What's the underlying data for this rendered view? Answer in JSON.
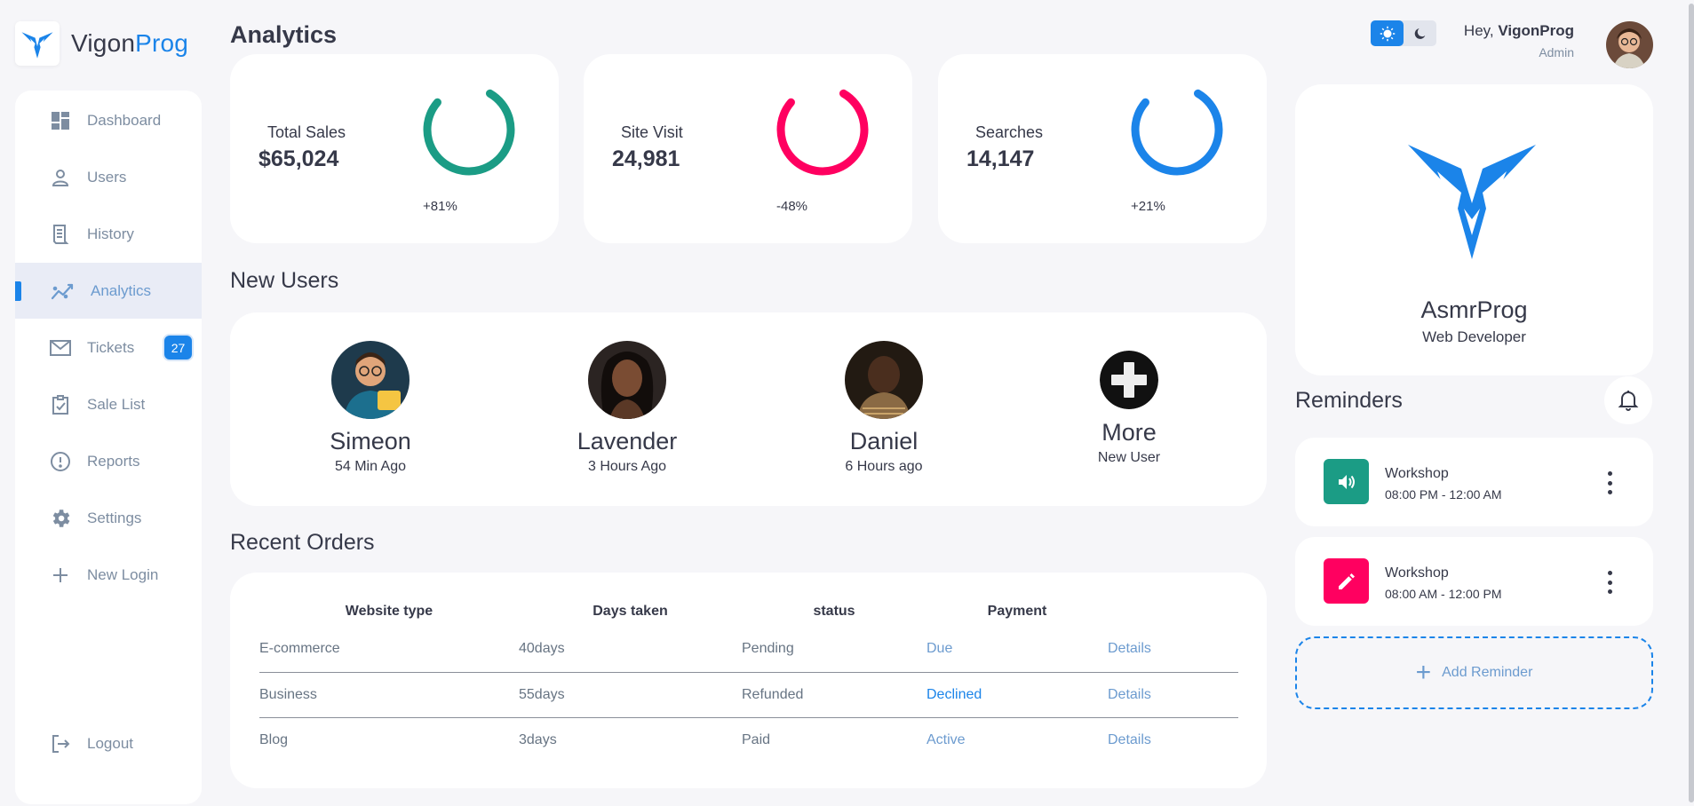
{
  "brand": {
    "name_part1": "Vigon",
    "name_part2": "Prog",
    "accent_color": "#1b84e9"
  },
  "sidebar": {
    "items": [
      {
        "label": "Dashboard",
        "icon": "dashboard-icon"
      },
      {
        "label": "Users",
        "icon": "person-icon"
      },
      {
        "label": "History",
        "icon": "receipt-icon"
      },
      {
        "label": "Analytics",
        "icon": "analytics-icon",
        "active": true
      },
      {
        "label": "Tickets",
        "icon": "mail-icon",
        "badge": "27"
      },
      {
        "label": "Sale List",
        "icon": "clipboard-check-icon"
      },
      {
        "label": "Reports",
        "icon": "report-icon"
      },
      {
        "label": "Settings",
        "icon": "gear-icon"
      },
      {
        "label": "New Login",
        "icon": "plus-icon"
      },
      {
        "label": "Logout",
        "icon": "logout-icon"
      }
    ]
  },
  "page_title": "Analytics",
  "stats": [
    {
      "label": "Total Sales",
      "value": "$65,024",
      "change": "+81%",
      "color": "#1b9c85",
      "icon": "ring-icon"
    },
    {
      "label": "Site Visit",
      "value": "24,981",
      "change": "-48%",
      "color": "#ff0060",
      "icon": "ring-icon"
    },
    {
      "label": "Searches",
      "value": "14,147",
      "change": "+21%",
      "color": "#1b84e9",
      "icon": "ring-icon"
    }
  ],
  "new_users": {
    "title": "New Users",
    "items": [
      {
        "name": "Simeon",
        "time": "54 Min Ago"
      },
      {
        "name": "Lavender",
        "time": "3 Hours Ago"
      },
      {
        "name": "Daniel",
        "time": "6 Hours ago"
      },
      {
        "name": "More",
        "time": "New User"
      }
    ]
  },
  "recent_orders": {
    "title": "Recent Orders",
    "headers": [
      "Website type",
      "Days taken",
      "status",
      "Payment",
      ""
    ],
    "rows": [
      [
        "E-commerce",
        "40days",
        "Pending",
        "Due",
        "Details"
      ],
      [
        "Business",
        "55days",
        "Refunded",
        "Declined",
        "Details"
      ],
      [
        "Blog",
        "3days",
        "Paid",
        "Active",
        "Details"
      ]
    ]
  },
  "header": {
    "greeting_prefix": "Hey,",
    "user_name": "VigonProg",
    "role": "Admin",
    "theme_light_icon": "sun-icon",
    "theme_dark_icon": "moon-icon"
  },
  "profile": {
    "name": "AsmrProg",
    "role": "Web Developer"
  },
  "reminders": {
    "title": "Reminders",
    "items": [
      {
        "title": "Workshop",
        "time": "08:00 PM - 12:00 AM",
        "color": "#1b9c85",
        "icon": "volume-icon"
      },
      {
        "title": "Workshop",
        "time": "08:00 AM - 12:00 PM",
        "color": "#ff0060",
        "icon": "pencil-icon"
      }
    ],
    "add_label": "Add Reminder"
  }
}
